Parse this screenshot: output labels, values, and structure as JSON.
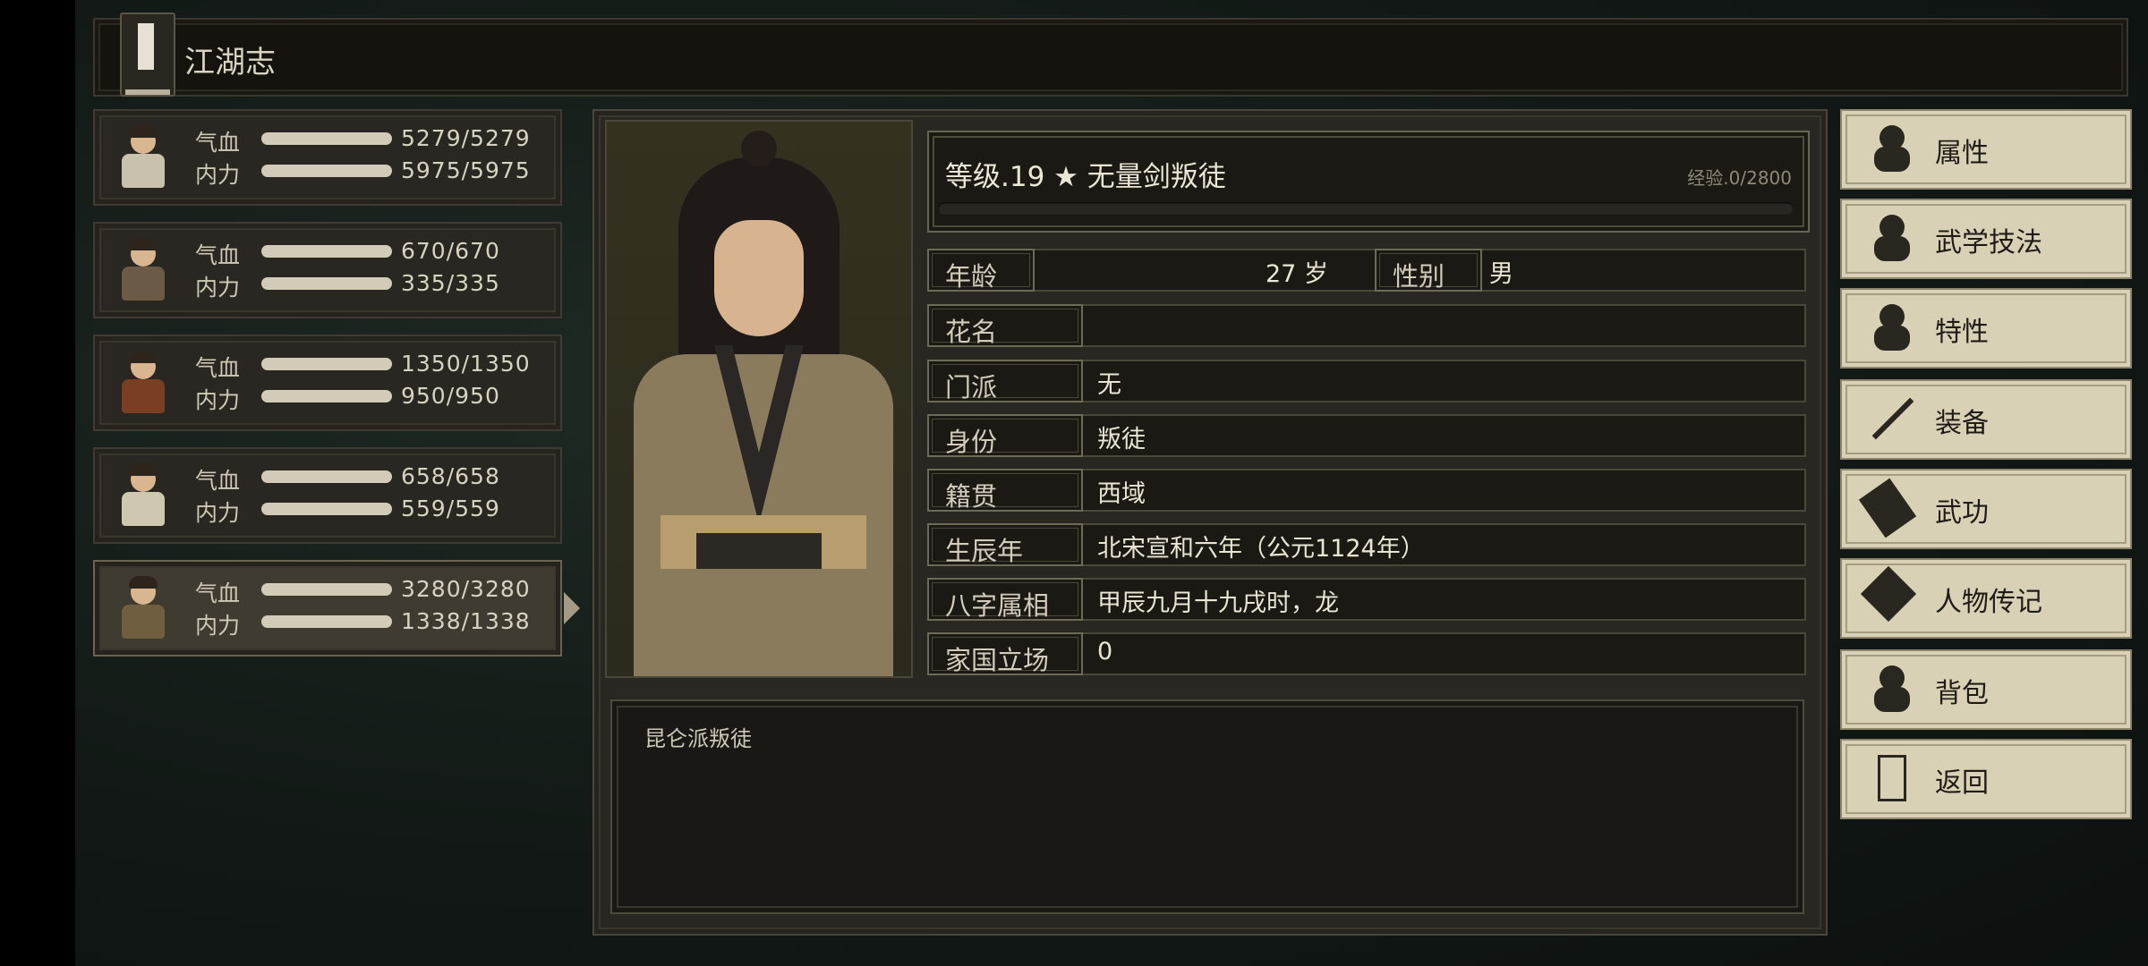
{
  "title_bar": {
    "title": "江湖志",
    "icon": "book-icon"
  },
  "party": [
    {
      "hp_label": "气血",
      "hp": "5279/5279",
      "mp_label": "内力",
      "mp": "5975/5975",
      "hp_fill": 1.0,
      "mp_fill": 1.0,
      "selected": false
    },
    {
      "hp_label": "气血",
      "hp": "670/670",
      "mp_label": "内力",
      "mp": "335/335",
      "hp_fill": 1.0,
      "mp_fill": 1.0,
      "selected": false
    },
    {
      "hp_label": "气血",
      "hp": "1350/1350",
      "mp_label": "内力",
      "mp": "950/950",
      "hp_fill": 1.0,
      "mp_fill": 1.0,
      "selected": false
    },
    {
      "hp_label": "气血",
      "hp": "658/658",
      "mp_label": "内力",
      "mp": "559/559",
      "hp_fill": 1.0,
      "mp_fill": 1.0,
      "selected": false
    },
    {
      "hp_label": "气血",
      "hp": "3280/3280",
      "mp_label": "内力",
      "mp": "1338/1338",
      "hp_fill": 1.0,
      "mp_fill": 1.0,
      "selected": true
    }
  ],
  "character": {
    "level_line": "等级.19 ★ 无量剑叛徒",
    "exp": "经验.0/2800",
    "exp_fill": 0.0,
    "age_label": "年龄",
    "age_value": "27 岁",
    "gender_label": "性别",
    "gender_value": "男",
    "fields": [
      {
        "label": "花名",
        "value": ""
      },
      {
        "label": "门派",
        "value": "无"
      },
      {
        "label": "身份",
        "value": "叛徒"
      },
      {
        "label": "籍贯",
        "value": "西域"
      },
      {
        "label": "生辰年",
        "value": "北宋宣和六年（公元1124年）"
      },
      {
        "label": "八字属相",
        "value": "甲辰九月十九戌时，龙"
      },
      {
        "label": "家国立场",
        "value": "0"
      }
    ],
    "description": "昆仑派叛徒"
  },
  "menu": [
    {
      "label": "属性",
      "icon": "character-attributes-icon"
    },
    {
      "label": "武学技法",
      "icon": "martial-skills-icon"
    },
    {
      "label": "特性",
      "icon": "traits-icon"
    },
    {
      "label": "装备",
      "icon": "sword-icon"
    },
    {
      "label": "武功",
      "icon": "manual-book-icon"
    },
    {
      "label": "人物传记",
      "icon": "scroll-icon"
    },
    {
      "label": "背包",
      "icon": "bag-icon"
    },
    {
      "label": "返回",
      "icon": "door-icon"
    }
  ]
}
